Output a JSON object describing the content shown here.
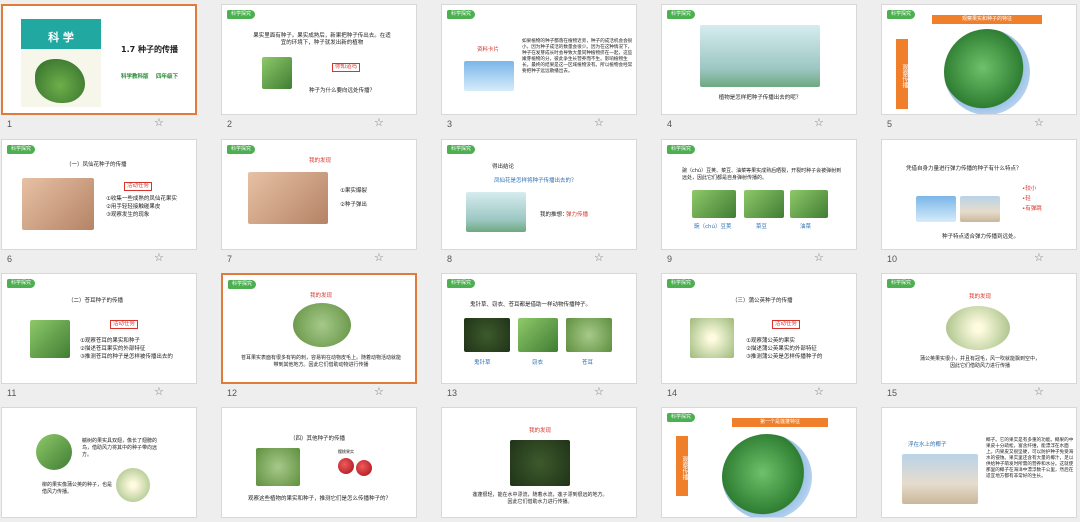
{
  "slides": [
    {
      "num": "1",
      "tag": "",
      "cover_title": "科 学",
      "title": "1.7 种子的传播",
      "sub_a": "科学教科版",
      "sub_b": "四年级下"
    },
    {
      "num": "2",
      "tag": "科学探究",
      "text1": "果实里面有种子。果实成熟后，新果把种子传出去。在适宜的环境下，种子就发出新的植物",
      "question_label": "你知道吗",
      "text2": "种子为什么要向远处传播？"
    },
    {
      "num": "3",
      "tag": "科学探究",
      "label": "资料卡片",
      "text": "如果植物的种子都落在植物近旁，种子的成活机会会很小，因为种子成活的数量会很少。因为在这种情况下，种子在发芽成长时会导致大量同种植物挤在一起，这些嫩芽植物的分，彼此争生长营养而不生。影响植物生长。最终的结果是这一区域植物没有。所以植物会经常要把种子远远散播出去。"
    },
    {
      "num": "4",
      "tag": "科学探究",
      "text": "植物是怎样把种子传播出去的呢？"
    },
    {
      "num": "5",
      "tag": "科学探究",
      "banner": "观察果实和种子的特征",
      "side": "观察传播"
    },
    {
      "num": "6",
      "tag": "科学探究",
      "title": "（一）凤仙花种子的传播",
      "task": "活动任务",
      "items": [
        "①收集一些成熟的凤仙花果实",
        "②用手轻轻接触碰果皮",
        "③观察发生的现象"
      ]
    },
    {
      "num": "7",
      "tag": "科学探究",
      "title": "我的发现",
      "items": [
        "①果实爆裂",
        "②种子弹出"
      ]
    },
    {
      "num": "8",
      "tag": "科学探究",
      "title": "得出结论",
      "question": "凤仙花是怎样将种子传播出去的？",
      "answer_prefix": "我的推想：",
      "answer": "弹力传播"
    },
    {
      "num": "9",
      "tag": "科学探究",
      "text": "豌（chú）豆荚、菜豆、油菜等果实成熟后晒裂，开裂时种子会被弹射到远处，因此它们都是自身弹射传播的。",
      "labels": [
        "豌（chú）豆荚",
        "菜豆",
        "油菜"
      ]
    },
    {
      "num": "10",
      "tag": "科学探究",
      "text": "凭借自身力量进行弹力传播的种子有什么特点？",
      "points": [
        "•较小",
        "•轻",
        "•有弹跳"
      ],
      "conclusion": "种子特点适合弹力传播到远处。"
    },
    {
      "num": "11",
      "tag": "科学探究",
      "title": "（二）苍耳种子的传播",
      "task": "活动任务",
      "items": [
        "①观察苍耳的果实和种子",
        "②描述苍耳果实的外部特征",
        "③推测苍耳的种子是怎样被传播出去的"
      ]
    },
    {
      "num": "12",
      "tag": "科学探究",
      "title": "我的发现",
      "text": "苍耳果实表面有很多有钩的刺，容易钩在动物皮毛上。随着动物活动就能带到其他地方。因此它们借助动物进行传播"
    },
    {
      "num": "13",
      "tag": "科学探究",
      "text": "鬼针草、窃衣、苍耳都是借助一样动物传播种子。",
      "labels": [
        "鬼针草",
        "窃衣",
        "苍耳"
      ]
    },
    {
      "num": "14",
      "tag": "科学探究",
      "title": "（三）蒲公英种子的传播",
      "task": "活动任务",
      "items": [
        "①观察蒲公英的果实",
        "②描述蒲公英果实的外部特征",
        "③推测蒲公英是怎样传播种子的"
      ]
    },
    {
      "num": "15",
      "tag": "科学探究",
      "title": "我的发现",
      "text": "蒲公英果实很小，并且有冠毛，风一吹就能飘到空中，因此它们借助风力进行传播"
    },
    {
      "num": "16",
      "tag": "",
      "text1": "槭树的果实具双翅，像长了翅膀的鸟，借助风力将其中的种子带向远方。",
      "text2": "柳的果实像蒲公英的种子，也是借风力传播。"
    },
    {
      "num": "17",
      "tag": "",
      "title": "（四）其他种子的传播",
      "text": "观察这些植物的果实和种子，推测它们是怎么传播种子的？",
      "label_a": "樱桃果实"
    },
    {
      "num": "18",
      "tag": "",
      "title": "我的发现",
      "text": "莲蓬很轻，能在水中漂流，随着水流，莲子漂到很远的地方。因此它们借助水力进行传播。"
    },
    {
      "num": "19",
      "tag": "科学探究",
      "banner": "第一个是莲蓬特征",
      "side": "观察传播"
    },
    {
      "num": "20",
      "tag": "",
      "label": "浮在水上的椰子",
      "text": "椰子。它的果实是有多重的功能。椰果的中果皮十分疏松，富含纤维，能漂浮在水面上。内果皮又很坚硬，可以防护种子免受海水的侵蚀。果实里还含有大量的椰汁，足以供给种子萌发时所需的营养和水分。这就使那里的椰子在海洋中漂浮数千公里，然后在适宜地方都有非常好的生长。"
    }
  ],
  "colors": {
    "accent": "#e07b39",
    "tag": "#4caf50",
    "banner": "#ef7f2b",
    "red": "#d9342b"
  },
  "icons": {
    "star": "☆"
  }
}
